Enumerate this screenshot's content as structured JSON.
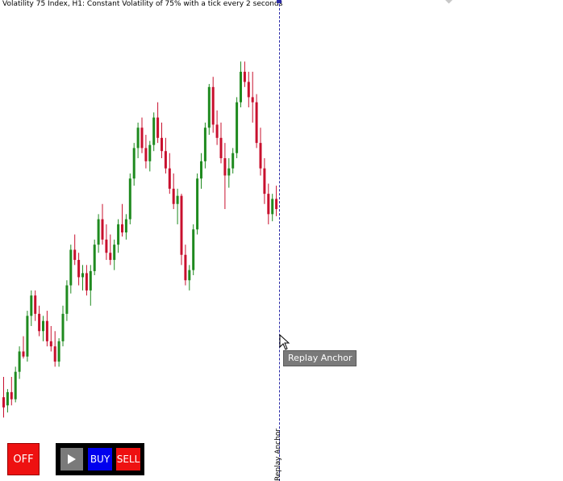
{
  "chart": {
    "title": "Volatility 75 Index, H1:  Constant Volatility of 75% with a tick every 2 seconds"
  },
  "replay_anchor": {
    "vertical_label": "Replay Anchor",
    "tooltip": "Replay Anchor"
  },
  "controls": {
    "off_label": "OFF",
    "play_icon": "play-icon",
    "buy_label": "BUY",
    "sell_label": "SELL"
  },
  "colors": {
    "bull": "#1f8a1f",
    "bear": "#c8102e",
    "anchor": "#2a2aa8",
    "off": "#ee1111",
    "buy": "#0000ee",
    "sell": "#ee1111"
  },
  "chart_data": {
    "type": "candlestick",
    "series": [
      {
        "o": 470,
        "h": 490,
        "l": 450,
        "c": 460
      },
      {
        "o": 462,
        "h": 478,
        "l": 455,
        "c": 475
      },
      {
        "o": 475,
        "h": 490,
        "l": 462,
        "c": 468
      },
      {
        "o": 468,
        "h": 500,
        "l": 465,
        "c": 495
      },
      {
        "o": 495,
        "h": 520,
        "l": 488,
        "c": 515
      },
      {
        "o": 515,
        "h": 530,
        "l": 508,
        "c": 510
      },
      {
        "o": 510,
        "h": 555,
        "l": 505,
        "c": 550
      },
      {
        "o": 550,
        "h": 575,
        "l": 540,
        "c": 570
      },
      {
        "o": 570,
        "h": 575,
        "l": 545,
        "c": 552
      },
      {
        "o": 552,
        "h": 560,
        "l": 530,
        "c": 535
      },
      {
        "o": 535,
        "h": 550,
        "l": 525,
        "c": 545
      },
      {
        "o": 545,
        "h": 555,
        "l": 520,
        "c": 525
      },
      {
        "o": 525,
        "h": 540,
        "l": 515,
        "c": 520
      },
      {
        "o": 520,
        "h": 535,
        "l": 500,
        "c": 505
      },
      {
        "o": 505,
        "h": 528,
        "l": 500,
        "c": 525
      },
      {
        "o": 525,
        "h": 560,
        "l": 520,
        "c": 552
      },
      {
        "o": 552,
        "h": 585,
        "l": 545,
        "c": 580
      },
      {
        "o": 580,
        "h": 620,
        "l": 572,
        "c": 615
      },
      {
        "o": 615,
        "h": 630,
        "l": 600,
        "c": 605
      },
      {
        "o": 605,
        "h": 612,
        "l": 580,
        "c": 588
      },
      {
        "o": 588,
        "h": 600,
        "l": 575,
        "c": 592
      },
      {
        "o": 592,
        "h": 600,
        "l": 570,
        "c": 575
      },
      {
        "o": 575,
        "h": 600,
        "l": 560,
        "c": 594
      },
      {
        "o": 594,
        "h": 625,
        "l": 590,
        "c": 620
      },
      {
        "o": 620,
        "h": 650,
        "l": 612,
        "c": 645
      },
      {
        "o": 645,
        "h": 660,
        "l": 620,
        "c": 625
      },
      {
        "o": 625,
        "h": 640,
        "l": 605,
        "c": 612
      },
      {
        "o": 612,
        "h": 630,
        "l": 600,
        "c": 605
      },
      {
        "o": 605,
        "h": 625,
        "l": 595,
        "c": 620
      },
      {
        "o": 620,
        "h": 645,
        "l": 612,
        "c": 640
      },
      {
        "o": 640,
        "h": 660,
        "l": 628,
        "c": 632
      },
      {
        "o": 632,
        "h": 650,
        "l": 625,
        "c": 645
      },
      {
        "o": 645,
        "h": 690,
        "l": 640,
        "c": 685
      },
      {
        "o": 685,
        "h": 720,
        "l": 678,
        "c": 715
      },
      {
        "o": 715,
        "h": 740,
        "l": 705,
        "c": 735
      },
      {
        "o": 735,
        "h": 745,
        "l": 710,
        "c": 715
      },
      {
        "o": 715,
        "h": 728,
        "l": 695,
        "c": 702
      },
      {
        "o": 702,
        "h": 722,
        "l": 692,
        "c": 718
      },
      {
        "o": 718,
        "h": 750,
        "l": 712,
        "c": 745
      },
      {
        "o": 745,
        "h": 760,
        "l": 720,
        "c": 725
      },
      {
        "o": 725,
        "h": 740,
        "l": 705,
        "c": 712
      },
      {
        "o": 712,
        "h": 725,
        "l": 690,
        "c": 695
      },
      {
        "o": 695,
        "h": 710,
        "l": 670,
        "c": 675
      },
      {
        "o": 675,
        "h": 690,
        "l": 655,
        "c": 660
      },
      {
        "o": 660,
        "h": 675,
        "l": 640,
        "c": 668
      },
      {
        "o": 668,
        "h": 670,
        "l": 600,
        "c": 610
      },
      {
        "o": 610,
        "h": 620,
        "l": 580,
        "c": 585
      },
      {
        "o": 585,
        "h": 600,
        "l": 575,
        "c": 595
      },
      {
        "o": 595,
        "h": 640,
        "l": 590,
        "c": 635
      },
      {
        "o": 635,
        "h": 690,
        "l": 630,
        "c": 685
      },
      {
        "o": 685,
        "h": 710,
        "l": 675,
        "c": 702
      },
      {
        "o": 702,
        "h": 740,
        "l": 695,
        "c": 735
      },
      {
        "o": 735,
        "h": 778,
        "l": 728,
        "c": 775
      },
      {
        "o": 775,
        "h": 785,
        "l": 730,
        "c": 738
      },
      {
        "o": 738,
        "h": 752,
        "l": 718,
        "c": 725
      },
      {
        "o": 725,
        "h": 740,
        "l": 700,
        "c": 705
      },
      {
        "o": 705,
        "h": 720,
        "l": 655,
        "c": 688
      },
      {
        "o": 688,
        "h": 705,
        "l": 676,
        "c": 695
      },
      {
        "o": 695,
        "h": 715,
        "l": 690,
        "c": 710
      },
      {
        "o": 710,
        "h": 765,
        "l": 705,
        "c": 760
      },
      {
        "o": 760,
        "h": 800,
        "l": 755,
        "c": 790
      },
      {
        "o": 790,
        "h": 800,
        "l": 775,
        "c": 780
      },
      {
        "o": 780,
        "h": 790,
        "l": 755,
        "c": 765
      },
      {
        "o": 765,
        "h": 790,
        "l": 740,
        "c": 760
      },
      {
        "o": 760,
        "h": 768,
        "l": 715,
        "c": 720
      },
      {
        "o": 720,
        "h": 735,
        "l": 688,
        "c": 695
      },
      {
        "o": 695,
        "h": 705,
        "l": 660,
        "c": 670
      },
      {
        "o": 670,
        "h": 680,
        "l": 640,
        "c": 650
      },
      {
        "o": 650,
        "h": 670,
        "l": 643,
        "c": 665
      },
      {
        "o": 665,
        "h": 678,
        "l": 648,
        "c": 655
      }
    ]
  }
}
